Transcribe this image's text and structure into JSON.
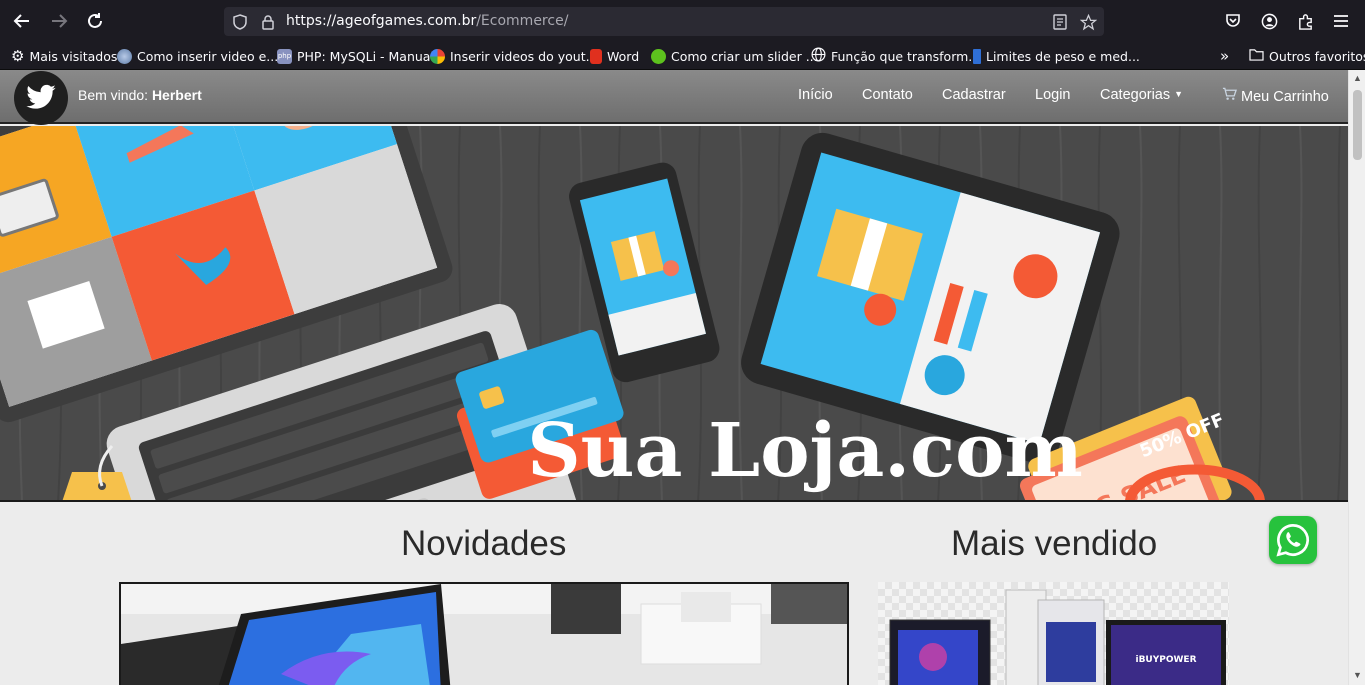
{
  "browser": {
    "url_host": "https://ageofgames.com.br",
    "url_path": "/Ecommerce/",
    "bookmarks": [
      {
        "label": "Mais visitados",
        "icon": "gear-icon"
      },
      {
        "label": "Como inserir video e...",
        "icon": "globe-favicon"
      },
      {
        "label": "PHP: MySQLi - Manual",
        "icon": "php-favicon"
      },
      {
        "label": "Inserir videos do yout...",
        "icon": "google-favicon"
      },
      {
        "label": "Word",
        "icon": "office-favicon"
      },
      {
        "label": "Como criar um slider ...",
        "icon": "xbox-favicon"
      },
      {
        "label": "Função que transform...",
        "icon": "globe-icon"
      },
      {
        "label": "Limites de peso e med...",
        "icon": "bookmark-favicon"
      }
    ],
    "other_bookmarks": "Outros favoritos"
  },
  "navbar": {
    "welcome_prefix": "Bem vindo:",
    "username": "Herbert",
    "items": [
      "Início",
      "Contato",
      "Cadastrar",
      "Login",
      "Categorias"
    ],
    "cart": "Meu Carrinho"
  },
  "banner": {
    "title": "Sua Loja.com",
    "badge_top": "50% OFF",
    "badge_sale": "BIG SALE"
  },
  "sections": {
    "news_title": "Novidades",
    "best_title": "Mais vendido",
    "best_brand": "iBUYPOWER"
  }
}
